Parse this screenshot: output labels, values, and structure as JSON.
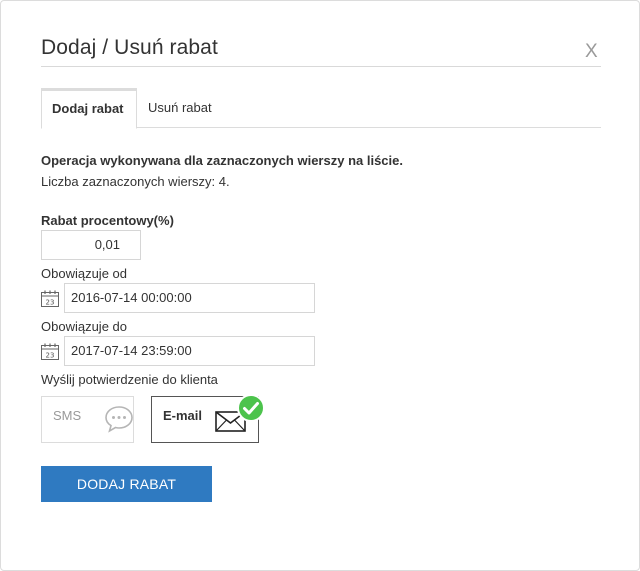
{
  "dialog": {
    "title": "Dodaj / Usuń rabat",
    "close_label": "X"
  },
  "tabs": [
    {
      "label": "Dodaj rabat",
      "active": true
    },
    {
      "label": "Usuń rabat",
      "active": false
    }
  ],
  "info": {
    "operation": "Operacja wykonywana dla zaznaczonych wierszy na liście.",
    "selected_count": "Liczba zaznaczonych wierszy: 4."
  },
  "form": {
    "discount_label": "Rabat procentowy(%)",
    "discount_value": "0,01",
    "valid_from_label": "Obowiązuje od",
    "valid_from_value": "2016-07-14 00:00:00",
    "valid_to_label": "Obowiązuje do",
    "valid_to_value": "2017-07-14 23:59:00",
    "confirm_label": "Wyślij potwierdzenie do klienta",
    "channels": [
      {
        "label": "SMS",
        "icon": "speech-bubble-icon",
        "selected": false
      },
      {
        "label": "E-mail",
        "icon": "envelope-icon",
        "selected": true
      }
    ],
    "submit_label": "DODAJ RABAT"
  },
  "colors": {
    "primary": "#2f7ac1",
    "check": "#4cc34c"
  }
}
